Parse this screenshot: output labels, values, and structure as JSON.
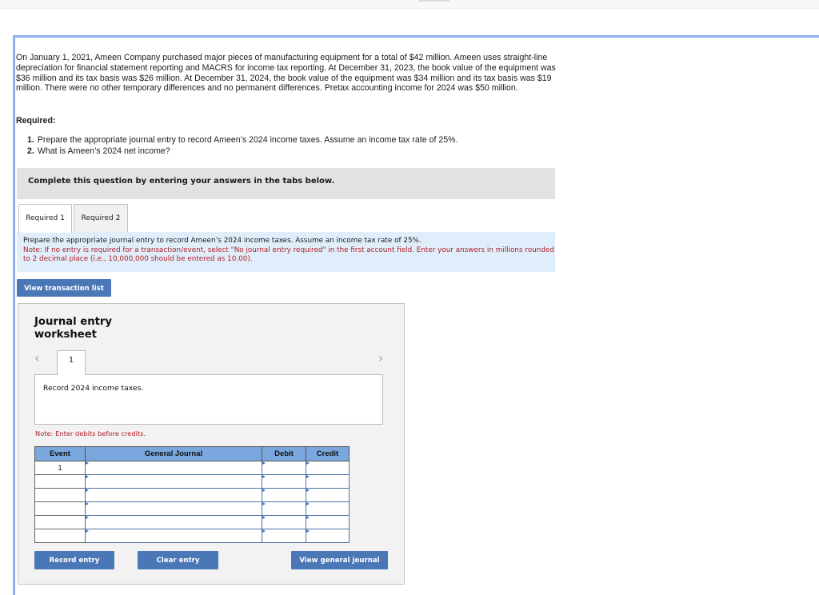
{
  "problem": {
    "text": "On January 1, 2021, Ameen Company purchased major pieces of manufacturing equipment for a total of $42 million. Ameen uses straight-line depreciation for financial statement reporting and MACRS for income tax reporting. At December 31, 2023, the book value of the equipment was $36 million and its tax basis was $26 million. At December 31, 2024, the book value of the equipment was $34 million and its tax basis was $19 million. There were no other temporary differences and no permanent differences. Pretax accounting income for 2024 was $50 million."
  },
  "required": {
    "label": "Required:",
    "items": [
      {
        "num": "1.",
        "text": "Prepare the appropriate journal entry to record Ameen’s 2024 income taxes. Assume an income tax rate of 25%."
      },
      {
        "num": "2.",
        "text": "What is Ameen’s 2024 net income?"
      }
    ]
  },
  "complete_banner": "Complete this question by entering your answers in the tabs below.",
  "tabs": [
    {
      "label": "Required 1",
      "active": true
    },
    {
      "label": "Required 2",
      "active": false
    }
  ],
  "instructions": {
    "main": "Prepare the appropriate journal entry to record Ameen’s 2024 income taxes. Assume an income tax rate of 25%.",
    "note": "Note: If no entry is required for a transaction/event, select \"No journal entry required\" in the first account field. Enter your answers in millions rounded to 2 decimal place (i.e., 10,000,000 should be entered as 10.00)."
  },
  "buttons": {
    "view_transaction_list": "View transaction list",
    "record_entry": "Record entry",
    "clear_entry": "Clear entry",
    "view_general_journal": "View general journal"
  },
  "worksheet": {
    "title": "Journal entry worksheet",
    "prev_icon": "‹",
    "next_icon": "›",
    "entry_number": "1",
    "description": "Record 2024 income taxes.",
    "note": "Note: Enter debits before credits.",
    "table": {
      "headers": [
        "Event",
        "General Journal",
        "Debit",
        "Credit"
      ],
      "rows": [
        {
          "event": "1",
          "account": "",
          "debit": "",
          "credit": ""
        },
        {
          "event": "",
          "account": "",
          "debit": "",
          "credit": ""
        },
        {
          "event": "",
          "account": "",
          "debit": "",
          "credit": ""
        },
        {
          "event": "",
          "account": "",
          "debit": "",
          "credit": ""
        },
        {
          "event": "",
          "account": "",
          "debit": "",
          "credit": ""
        },
        {
          "event": "",
          "account": "",
          "debit": "",
          "credit": ""
        }
      ]
    }
  },
  "colors": {
    "accent_button": "#4a78b6",
    "table_header": "#7aa7dd",
    "note_red": "#b0202a",
    "instructions_bg": "#dfeefa",
    "frame_border": "#8fb0ea"
  }
}
